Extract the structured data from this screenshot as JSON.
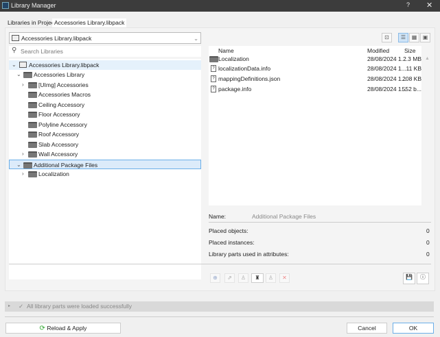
{
  "window": {
    "title": "Library Manager",
    "help": "?",
    "close": "✕"
  },
  "tabs": [
    "Libraries in Project",
    "Accessories Library.libpack"
  ],
  "library_dropdown": {
    "value": "Accessories Library.libpack"
  },
  "search": {
    "placeholder": "Search Libraries"
  },
  "tree": [
    {
      "label": "Accessories Library.libpack",
      "level": 0,
      "expanded": true,
      "icon": "library-icon"
    },
    {
      "label": "Accessories Library",
      "level": 1,
      "expanded": true,
      "icon": "folder-icon"
    },
    {
      "label": "[UImg] Accessories",
      "level": 2,
      "expandable": true,
      "icon": "folder-icon"
    },
    {
      "label": "Accessories Macros",
      "level": 2,
      "icon": "folder-icon"
    },
    {
      "label": "Ceiling Accessory",
      "level": 2,
      "icon": "folder-icon"
    },
    {
      "label": "Floor Accessory",
      "level": 2,
      "icon": "folder-icon"
    },
    {
      "label": "Polyline Accessory",
      "level": 2,
      "icon": "folder-icon"
    },
    {
      "label": "Roof Accessory",
      "level": 2,
      "icon": "folder-icon"
    },
    {
      "label": "Slab Accessory",
      "level": 2,
      "icon": "folder-icon"
    },
    {
      "label": "Wall Accessory",
      "level": 2,
      "expandable": true,
      "icon": "folder-icon"
    },
    {
      "label": "Additional Package Files",
      "level": 1,
      "expanded": true,
      "selected": true,
      "icon": "folder-icon"
    },
    {
      "label": "Localization",
      "level": 2,
      "expandable": true,
      "icon": "folder-icon"
    }
  ],
  "files": {
    "headers": [
      "Name",
      "Modified",
      "Size"
    ],
    "rows": [
      {
        "name": "Localization",
        "modified": "28/08/2024 1...",
        "size": "2.3 MB",
        "type": "folder"
      },
      {
        "name": "localizationData.info",
        "modified": "28/08/2024 1...",
        "size": "11 KB",
        "type": "file"
      },
      {
        "name": "mappingDefinitions.json",
        "modified": "28/08/2024 1...",
        "size": "208 KB",
        "type": "file"
      },
      {
        "name": "package.info",
        "modified": "28/08/2024 1...",
        "size": "552 b...",
        "type": "file"
      }
    ]
  },
  "details": {
    "name_label": "Name:",
    "name_value": "Additional Package Files",
    "placed_objects_label": "Placed objects:",
    "placed_objects": "0",
    "placed_instances_label": "Placed instances:",
    "placed_instances": "0",
    "attr_label": "Library parts used in attributes:",
    "attr_value": "0"
  },
  "status": {
    "message": "All library parts were loaded successfully"
  },
  "buttons": {
    "reload": "Reload & Apply",
    "cancel": "Cancel",
    "ok": "OK"
  }
}
